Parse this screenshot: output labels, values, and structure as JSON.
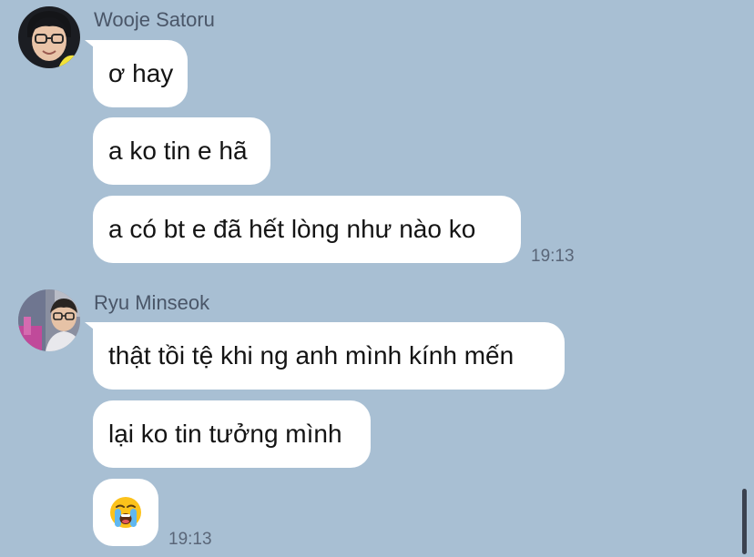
{
  "theme": {
    "background": "#a8bfd3",
    "bubble": "#ffffff",
    "text": "#141414",
    "meta_text": "#4a5668"
  },
  "conversation": {
    "groups": [
      {
        "sender": "Wooje Satoru",
        "avatar": "avatar-wooje",
        "messages": [
          "ơ hay",
          "a ko tin e hã",
          "a có bt e đã hết lòng như nào ko"
        ],
        "time": "19:13"
      },
      {
        "sender": "Ryu Minseok",
        "avatar": "avatar-minseok",
        "messages": [
          "thật tồi tệ khi ng anh mình kính mến",
          "lại ko tin tưởng mình"
        ],
        "emoji_message": "loudly-crying-face-emoji",
        "time": "19:13"
      }
    ]
  }
}
